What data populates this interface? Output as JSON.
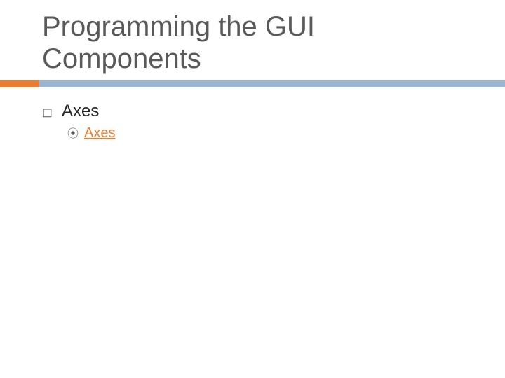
{
  "title": "Programming the GUI Components",
  "items": {
    "axes": {
      "label": "Axes",
      "sub": {
        "axes_link": {
          "label": "Axes"
        }
      }
    }
  },
  "colors": {
    "accent_orange": "#ed7d31",
    "accent_blue": "#9cb5d3",
    "title_gray": "#595959"
  }
}
